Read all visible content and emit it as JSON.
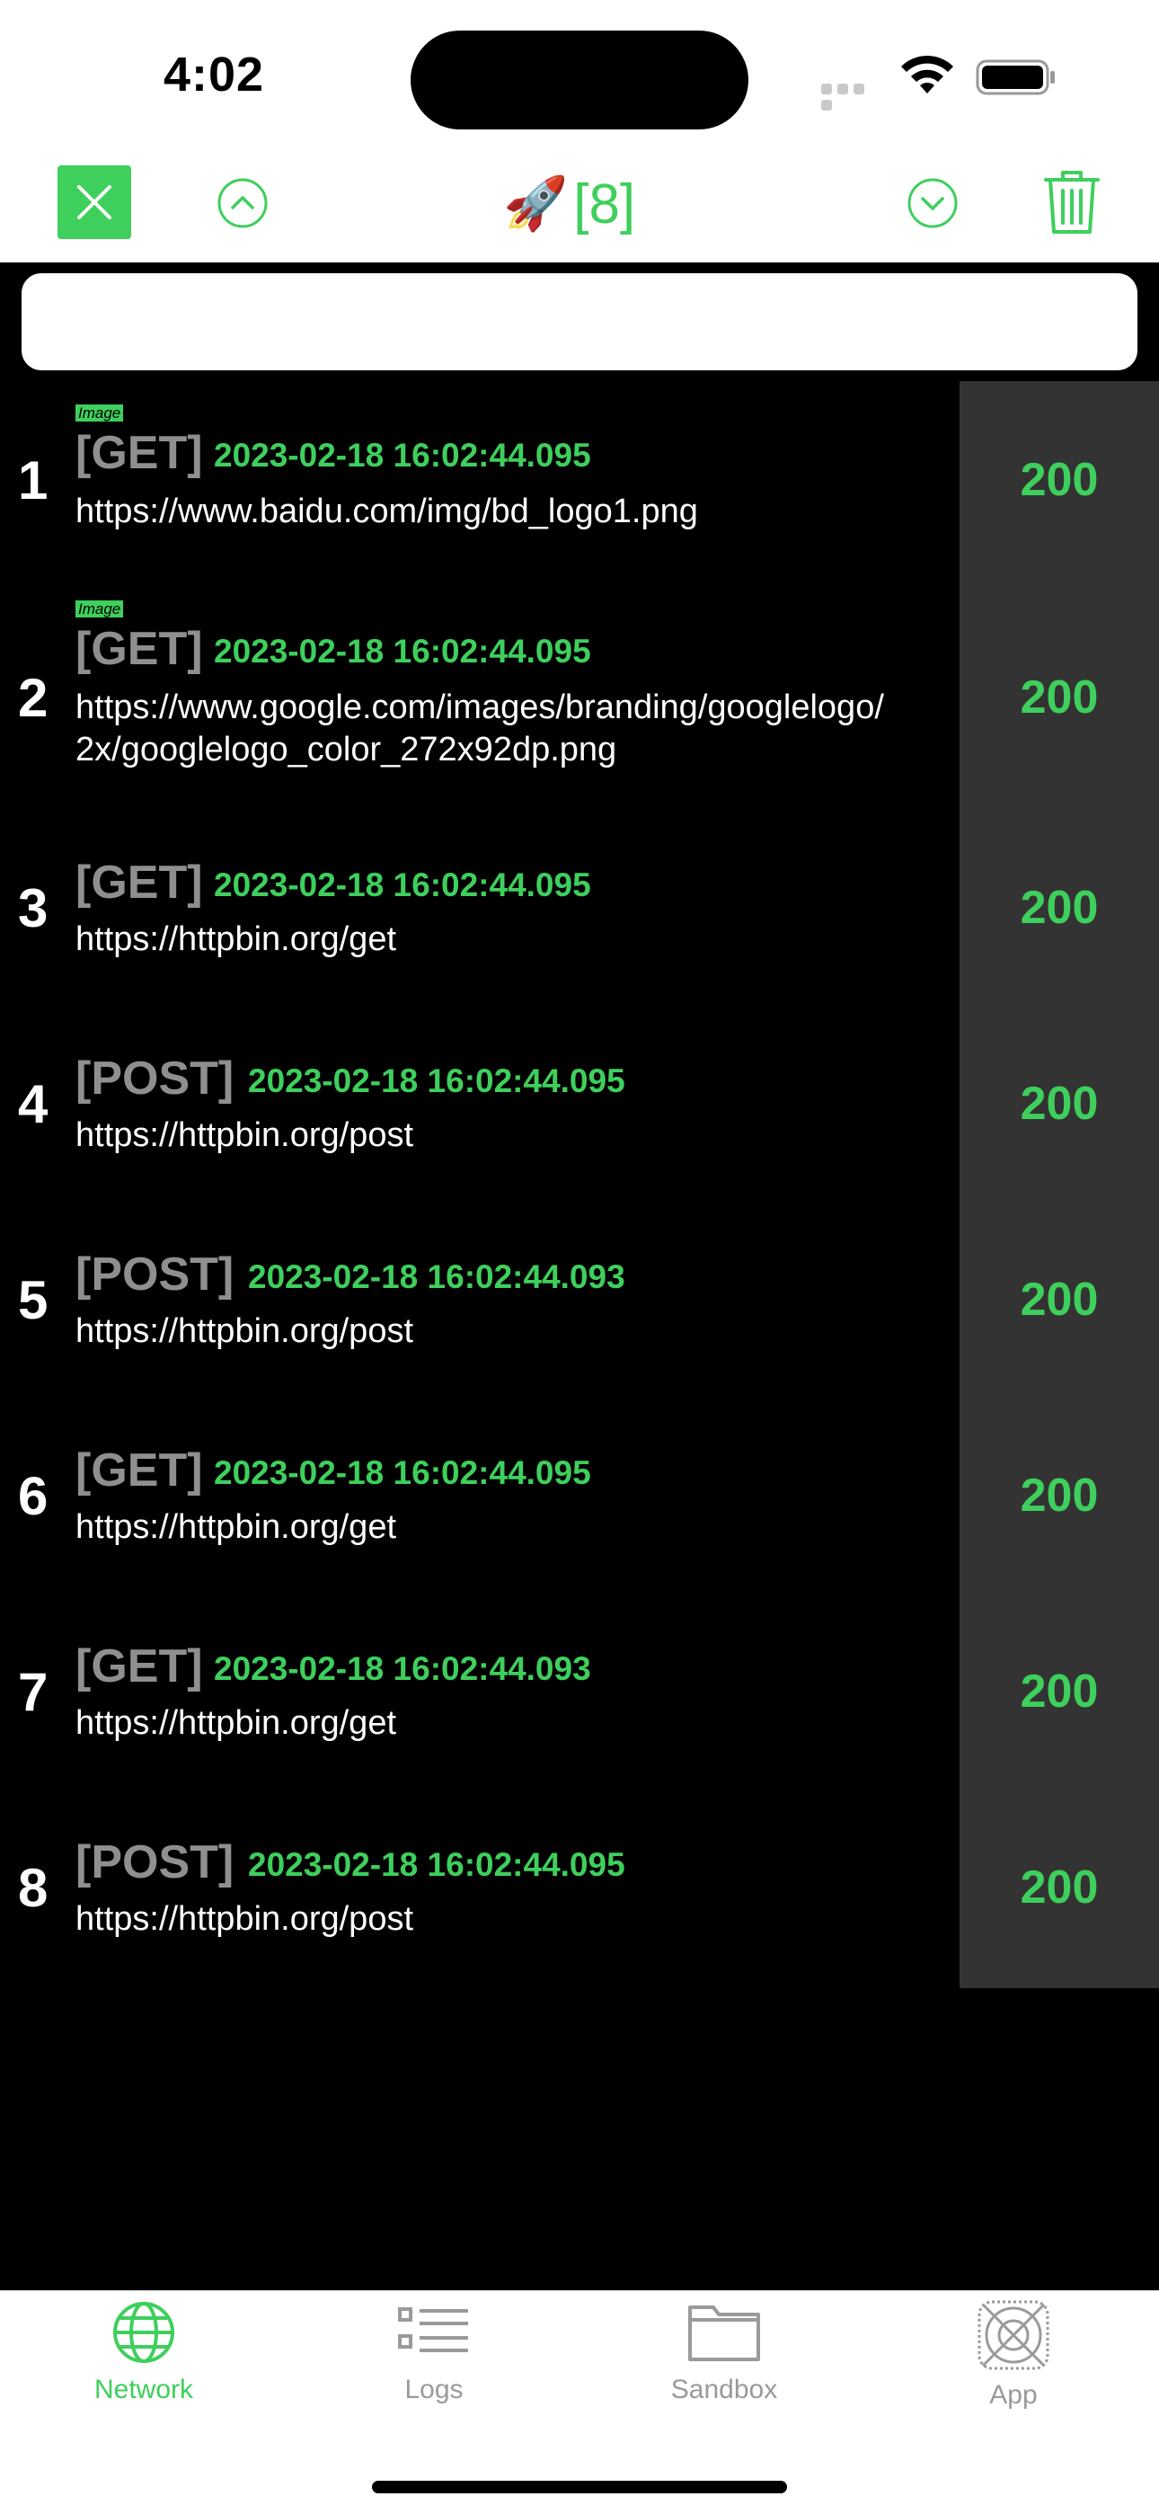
{
  "status_bar": {
    "time": "4:02"
  },
  "nav": {
    "title_emoji": "🚀",
    "title_count": "[8]",
    "icons": [
      "close-icon",
      "chevron-up-icon",
      "chevron-down-icon",
      "trash-icon"
    ]
  },
  "search": {
    "placeholder": "",
    "value": ""
  },
  "requests": [
    {
      "index": "1",
      "tag": "Image",
      "method": "[GET]",
      "timestamp": "2023-02-18 16:02:44.095",
      "url": "https://www.baidu.com/img/bd_logo1.png",
      "status": "200"
    },
    {
      "index": "2",
      "tag": "Image",
      "method": "[GET]",
      "timestamp": "2023-02-18 16:02:44.095",
      "url": "https://www.google.com/images/branding/googlelogo/2x/googlelogo_color_272x92dp.png",
      "status": "200"
    },
    {
      "index": "3",
      "tag": "",
      "method": "[GET]",
      "timestamp": "2023-02-18 16:02:44.095",
      "url": "https://httpbin.org/get",
      "status": "200"
    },
    {
      "index": "4",
      "tag": "",
      "method": "[POST]",
      "timestamp": "2023-02-18 16:02:44.095",
      "url": "https://httpbin.org/post",
      "status": "200"
    },
    {
      "index": "5",
      "tag": "",
      "method": "[POST]",
      "timestamp": "2023-02-18 16:02:44.093",
      "url": "https://httpbin.org/post",
      "status": "200"
    },
    {
      "index": "6",
      "tag": "",
      "method": "[GET]",
      "timestamp": "2023-02-18 16:02:44.095",
      "url": "https://httpbin.org/get",
      "status": "200"
    },
    {
      "index": "7",
      "tag": "",
      "method": "[GET]",
      "timestamp": "2023-02-18 16:02:44.093",
      "url": "https://httpbin.org/get",
      "status": "200"
    },
    {
      "index": "8",
      "tag": "",
      "method": "[POST]",
      "timestamp": "2023-02-18 16:02:44.095",
      "url": "https://httpbin.org/post",
      "status": "200"
    }
  ],
  "tabs": [
    {
      "label": "Network",
      "icon": "globe-icon",
      "active": true
    },
    {
      "label": "Logs",
      "icon": "list-icon",
      "active": false
    },
    {
      "label": "Sandbox",
      "icon": "folder-icon",
      "active": false
    },
    {
      "label": "App",
      "icon": "app-icon",
      "active": false
    }
  ],
  "colors": {
    "accent": "#3ecf5c",
    "background": "#000000",
    "status_column": "#333333",
    "method_gray": "#8f8f8f"
  }
}
